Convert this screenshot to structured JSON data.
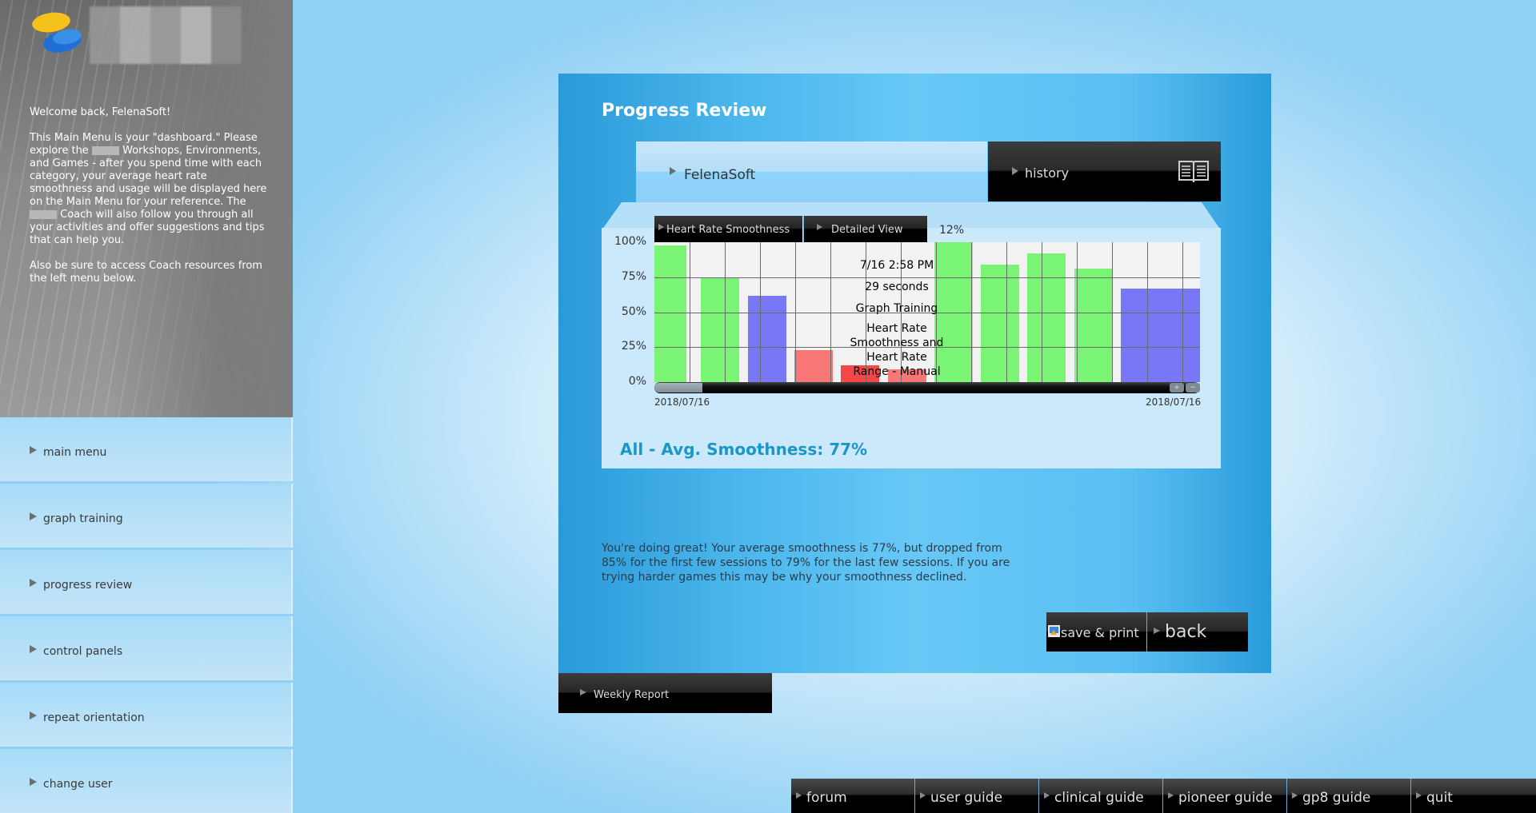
{
  "sidebar": {
    "welcome_title": "Welcome back, FelenaSoft!",
    "intro_parts": [
      "This Main Menu is your \"dashboard.\" Please explore the",
      "Workshops, Environments, and Games - after you spend time with each category, your average heart rate smoothness and usage will be displayed here on the Main Menu for your reference. The",
      "Coach will also follow you through all your activities and offer suggestions and tips that can help you."
    ],
    "coach_note": "Also be sure to access Coach resources from the left menu below.",
    "nav": [
      {
        "label": "main menu"
      },
      {
        "label": "graph training"
      },
      {
        "label": "progress review"
      },
      {
        "label": "control panels"
      },
      {
        "label": "repeat orientation"
      },
      {
        "label": "change user"
      }
    ]
  },
  "panel": {
    "title": "Progress Review",
    "user_name": "FelenaSoft",
    "history_label": "history",
    "tabs": [
      {
        "label": "Heart Rate Smoothness"
      },
      {
        "label": "Detailed View"
      }
    ],
    "selected_value_label": "12%",
    "avg_label": "All - Avg. Smoothness: 77%",
    "advice": "You're doing great!  Your average smoothness is 77%, but dropped from 85% for the first few sessions to 79% for the last few sessions. If you are trying harder games this may be why your smoothness declined.",
    "save_print_label": "save & print",
    "back_label": "back",
    "weekly_report_label": "Weekly Report"
  },
  "tooltip": {
    "datetime": "7/16 2:58 PM",
    "duration": "29 seconds",
    "activity": "Graph Training",
    "mode_lines": [
      "Heart Rate",
      "Smoothness and",
      "Heart Rate"
    ],
    "mode_last": "Range - Manual"
  },
  "chart_data": {
    "type": "bar",
    "title": "Heart Rate Smoothness",
    "ylabel": "",
    "xlabel": "",
    "ylim": [
      0,
      100
    ],
    "y_ticks": [
      "100%",
      "75%",
      "50%",
      "25%",
      "0%"
    ],
    "x_start_label": "2018/07/16",
    "x_end_label": "2018/07/16",
    "grid": true,
    "values": [
      98,
      75,
      62,
      23,
      12,
      9,
      100,
      84,
      92,
      81,
      67
    ],
    "colors": [
      "#6ff46a",
      "#6ff46a",
      "#6e6ef7",
      "#f76b6b",
      "#f43a3a",
      "#f76b6b",
      "#6ff46a",
      "#6ff46a",
      "#6ff46a",
      "#6ff46a",
      "#6e6ef7"
    ],
    "selected_index": 4
  },
  "footer": [
    {
      "label": "forum"
    },
    {
      "label": "user guide"
    },
    {
      "label": "clinical guide"
    },
    {
      "label": "pioneer guide"
    },
    {
      "label": "gp8 guide"
    },
    {
      "label": "quit"
    }
  ]
}
